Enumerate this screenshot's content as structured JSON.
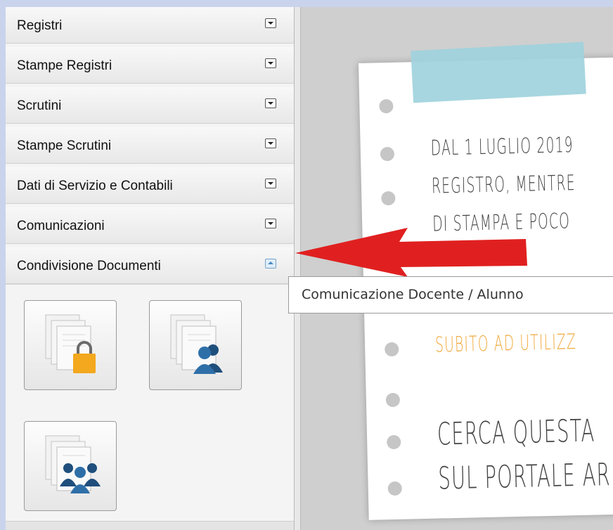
{
  "sidebar": {
    "sections": [
      {
        "label": "Registri",
        "expanded": false
      },
      {
        "label": "Stampe Registri",
        "expanded": false
      },
      {
        "label": "Scrutini",
        "expanded": false
      },
      {
        "label": "Stampe Scrutini",
        "expanded": false
      },
      {
        "label": "Dati di Servizio e Contabili",
        "expanded": false
      },
      {
        "label": "Comunicazioni",
        "expanded": false
      },
      {
        "label": "Condivisione Documenti",
        "expanded": true
      }
    ],
    "document_tiles": [
      {
        "icon": "documents-lock-icon"
      },
      {
        "icon": "documents-teacher-student-icon"
      },
      {
        "icon": "documents-group-icon"
      }
    ]
  },
  "tooltip": {
    "text": "Comunicazione Docente / Alunno"
  },
  "notice": {
    "line1": "DAL 1 LUGLIO 2019",
    "line2": "REGISTRO, MENTRE",
    "line3": "DI STAMPA E POCO",
    "line4": "SUBITO AD UTILIZZ",
    "line5": "CERCA QUESTA",
    "line6": "SUL PORTALE AR"
  },
  "colors": {
    "arrow": "#e02020",
    "tape": "#9fd3dd",
    "accent_text": "#f0a93d",
    "lock": "#f3a81e",
    "people": "#2f6fa8"
  }
}
